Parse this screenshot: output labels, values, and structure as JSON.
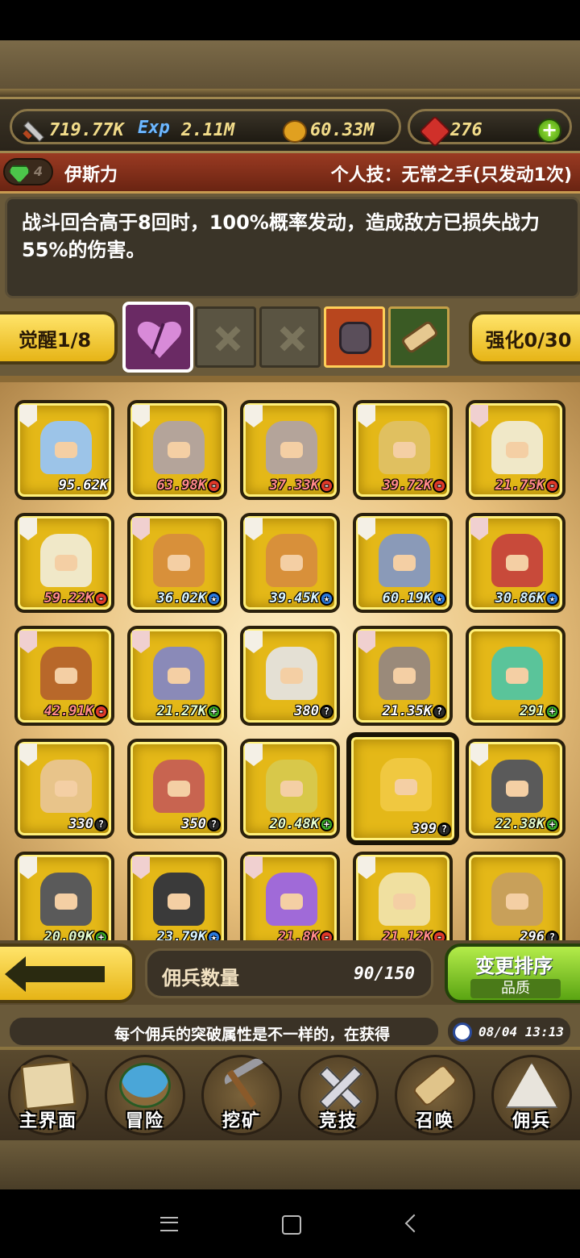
{
  "resources": {
    "attack": "719.77K",
    "exp_label": "Exp",
    "exp": "2.11M",
    "gold": "60.33M",
    "ruby": "276",
    "add_label": "+"
  },
  "hero": {
    "level": "4",
    "name": "伊斯力",
    "skill_title": "个人技：无常之手(只发动1次)",
    "description": "战斗回合高于8回时，100%概率发动，造成敌方已损失战力55%的伤害。"
  },
  "awaken": {
    "awaken_label": "觉醒1/8",
    "enhance_label": "强化0/30"
  },
  "heroes": [
    {
      "power": "95.62K",
      "mark": "",
      "markColor": "white",
      "tag": "paper",
      "color": "#9cc4e8"
    },
    {
      "power": "63.98K",
      "mark": "-",
      "markColor": "red",
      "tag": "paper",
      "color": "#b4a49a"
    },
    {
      "power": "37.33K",
      "mark": "-",
      "markColor": "red",
      "tag": "paper",
      "color": "#b4a49a"
    },
    {
      "power": "39.72K",
      "mark": "-",
      "markColor": "red",
      "tag": "paper",
      "color": "#e0c060"
    },
    {
      "power": "21.75K",
      "mark": "-",
      "markColor": "red",
      "tag": "sword",
      "color": "#f0e8c8"
    },
    {
      "power": "59.22K",
      "mark": "-",
      "markColor": "red",
      "tag": "paper",
      "color": "#f0e8c8"
    },
    {
      "power": "36.02K",
      "mark": "★",
      "markColor": "blue",
      "tag": "sword",
      "color": "#d8903a"
    },
    {
      "power": "39.45K",
      "mark": "★",
      "markColor": "blue",
      "tag": "paper",
      "color": "#d8903a"
    },
    {
      "power": "60.19K",
      "mark": "★",
      "markColor": "blue",
      "tag": "paper",
      "color": "#8a9ab8"
    },
    {
      "power": "30.86K",
      "mark": "★",
      "markColor": "blue",
      "tag": "sword",
      "color": "#c84a3a"
    },
    {
      "power": "42.91K",
      "mark": "-",
      "markColor": "red",
      "tag": "sword",
      "color": "#b8682a"
    },
    {
      "power": "21.27K",
      "mark": "+",
      "markColor": "green",
      "tag": "sword",
      "color": "#8a8ab8"
    },
    {
      "power": "380",
      "mark": "?",
      "markColor": "white",
      "tag": "paper",
      "color": "#e4e0d4"
    },
    {
      "power": "21.35K",
      "mark": "?",
      "markColor": "white",
      "tag": "sword",
      "color": "#9a8a7a"
    },
    {
      "power": "291",
      "mark": "+",
      "markColor": "green",
      "tag": "",
      "color": "#5ac49a"
    },
    {
      "power": "330",
      "mark": "?",
      "markColor": "white",
      "tag": "paper",
      "color": "#e8c48a"
    },
    {
      "power": "350",
      "mark": "?",
      "markColor": "white",
      "tag": "",
      "color": "#c86450"
    },
    {
      "power": "20.48K",
      "mark": "+",
      "markColor": "green",
      "tag": "paper",
      "color": "#d8c84a"
    },
    {
      "power": "399",
      "mark": "?",
      "markColor": "white",
      "tag": "",
      "color": "#f0c840",
      "selected": true
    },
    {
      "power": "22.38K",
      "mark": "+",
      "markColor": "green",
      "tag": "paper",
      "color": "#5a5a5a"
    },
    {
      "power": "20.09K",
      "mark": "+",
      "markColor": "green",
      "tag": "paper",
      "color": "#5a5a5a"
    },
    {
      "power": "23.79K",
      "mark": "★",
      "markColor": "blue",
      "tag": "sword",
      "color": "#3a3a3a"
    },
    {
      "power": "21.8K",
      "mark": "-",
      "markColor": "red",
      "tag": "sword",
      "color": "#a06ad8"
    },
    {
      "power": "21.12K",
      "mark": "-",
      "markColor": "red",
      "tag": "paper",
      "color": "#f0e0a0"
    },
    {
      "power": "296",
      "mark": "?",
      "markColor": "white",
      "tag": "",
      "color": "#c8a05a"
    }
  ],
  "count": {
    "label": "佣兵数量",
    "value": "90/150"
  },
  "sort": {
    "title": "变更排序",
    "mode": "品质"
  },
  "ticker": {
    "text": "每个佣兵的突破属性是不一样的，在获得"
  },
  "clock": {
    "time": "08/04 13:13"
  },
  "nav": [
    {
      "label": "主界面",
      "icon": "map-icon"
    },
    {
      "label": "冒险",
      "icon": "island-icon"
    },
    {
      "label": "挖矿",
      "icon": "pickaxe-icon"
    },
    {
      "label": "竞技",
      "icon": "crossed-swords-icon"
    },
    {
      "label": "召唤",
      "icon": "scroll-icon"
    },
    {
      "label": "佣兵",
      "icon": "tent-icon"
    }
  ],
  "colors": {
    "gold_button": "#e6b416",
    "green_button": "#5aa412",
    "name_bar": "#9a3a22"
  }
}
